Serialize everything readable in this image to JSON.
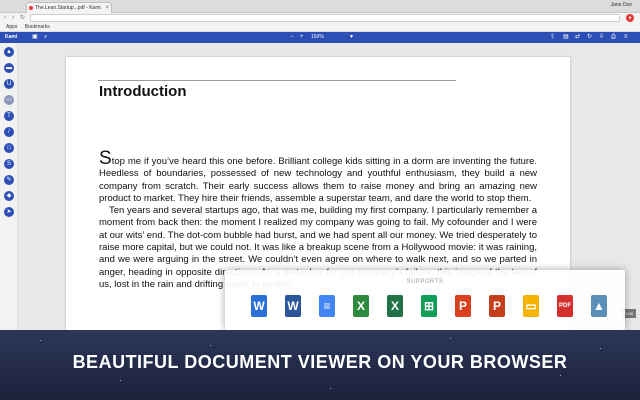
{
  "browser": {
    "tab_title": "The.Lean.Startup...pdf - Kami",
    "user": "Jane Doe",
    "url": "",
    "bookmarks": [
      "Apps",
      "Bookmarks"
    ]
  },
  "app": {
    "logo": "Kami",
    "zoom": "150%",
    "toolbar_icons": [
      "sidebar-icon",
      "search-icon",
      "zoom-out-icon",
      "zoom-in-icon",
      "dropdown-icon",
      "upload-icon",
      "folder-icon",
      "share-icon",
      "refresh-icon",
      "download-icon",
      "print-icon",
      "menu-icon"
    ]
  },
  "sidebar_tools": [
    "select",
    "highlight",
    "underline",
    "comment",
    "text",
    "draw",
    "shape",
    "strikethrough",
    "signature",
    "eraser",
    "pointer"
  ],
  "document": {
    "heading": "Introduction",
    "paragraph1_first": "S",
    "paragraph1_rest": "top me if you’ve heard this one before. Brilliant college kids sitting in a dorm are inventing the future. Heedless of boundaries, possessed of new technology and youthful enthusiasm, they build a new company from scratch. Their early success allows them to raise money and bring an amazing new product to market. They hire their friends, assemble a superstar team, and dare the world to stop them.",
    "paragraph2": "Ten years and several startups ago, that was me, building my first company. I particularly remember a moment from back then: the moment I realized my company was going to fail. My cofounder and I were at our wits’ end. The dot-com bubble had burst, and we had spent all our money. We tried desperately to raise more capital, but we could not. It was like a breakup scene from a Hollywood movie: it was raining, and we were arguing in the street. We couldn’t even agree on where to walk next, and so we parted in anger, heading in opposite directions. As a metaphor for our company’s failure, this image of the two of us, lost in the rain and drifting apart, is perfect."
  },
  "side_badge": "1/38",
  "supports": {
    "title": "SUPPORTS",
    "formats": [
      {
        "name": "wps-writer",
        "glyph": "W",
        "color": "#2a6fd6"
      },
      {
        "name": "word",
        "glyph": "W",
        "color": "#2b579a"
      },
      {
        "name": "google-docs",
        "glyph": "≡",
        "color": "#4285f4"
      },
      {
        "name": "wps-spreadsheet",
        "glyph": "X",
        "color": "#2e8b3d"
      },
      {
        "name": "excel",
        "glyph": "X",
        "color": "#217346"
      },
      {
        "name": "google-sheets",
        "glyph": "⊞",
        "color": "#0f9d58"
      },
      {
        "name": "wps-presentation",
        "glyph": "P",
        "color": "#d9401f"
      },
      {
        "name": "powerpoint",
        "glyph": "P",
        "color": "#c43e1c"
      },
      {
        "name": "google-slides",
        "glyph": "▭",
        "color": "#f4b400"
      },
      {
        "name": "pdf",
        "glyph": "PDF",
        "color": "#d32f2f"
      },
      {
        "name": "image",
        "glyph": "▲",
        "color": "#5c8fb8"
      }
    ]
  },
  "banner": "BEAUTIFUL DOCUMENT VIEWER ON YOUR BROWSER"
}
